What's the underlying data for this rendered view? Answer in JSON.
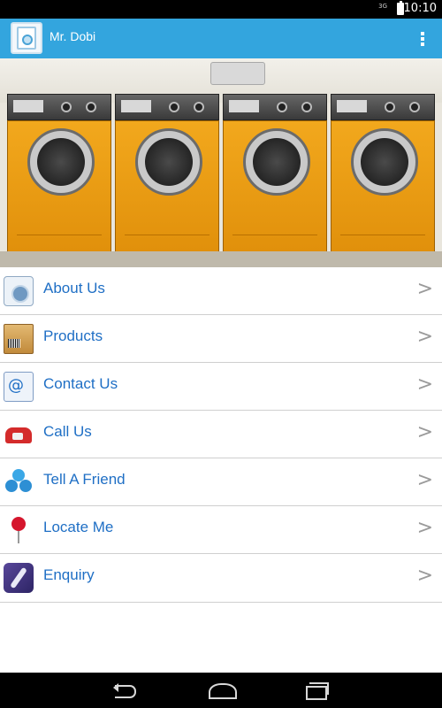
{
  "status_bar": {
    "network": "3G",
    "time": "10:10"
  },
  "action_bar": {
    "title": "Mr. Dobi",
    "app_icon": "washing-machine-icon",
    "overflow_icon": "overflow-menu-icon",
    "background_color": "#33a5de"
  },
  "hero": {
    "image": "laundromat-washers-photo",
    "machine_body_color": "#f2a81d"
  },
  "menu": {
    "items": [
      {
        "label": "About Us",
        "icon": "washing-machine-icon",
        "arrow": ">"
      },
      {
        "label": "Products",
        "icon": "box-barcode-icon",
        "arrow": ">"
      },
      {
        "label": "Contact Us",
        "icon": "email-phone-icon",
        "arrow": ">"
      },
      {
        "label": "Call Us",
        "icon": "telephone-icon",
        "arrow": ">"
      },
      {
        "label": "Tell A Friend",
        "icon": "people-share-icon",
        "arrow": ">"
      },
      {
        "label": "Locate Me",
        "icon": "map-pin-icon",
        "arrow": ">"
      },
      {
        "label": "Enquiry",
        "icon": "quill-pen-icon",
        "arrow": ">"
      }
    ],
    "label_color": "#1f6fc5"
  },
  "nav_bar": {
    "back": "back-icon",
    "home": "home-icon",
    "recents": "recents-icon"
  }
}
